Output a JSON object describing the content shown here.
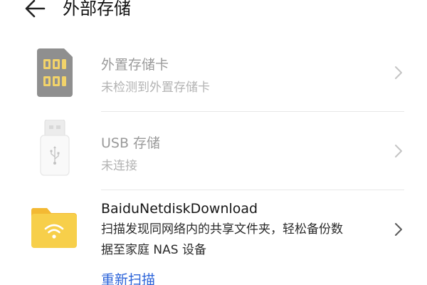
{
  "header": {
    "title": "外部存储",
    "back_icon": "arrow-left-icon"
  },
  "items": [
    {
      "title": "外置存储卡",
      "subtitle": "未检测到外置存储卡",
      "icon": "sim-card-icon",
      "state": "disabled"
    },
    {
      "title": "USB 存储",
      "subtitle": "未连接",
      "icon": "usb-drive-icon",
      "state": "disabled"
    },
    {
      "title": "BaiduNetdiskDownload",
      "subtitle_line1": "扫描发现同网络内的共享文件夹，轻松备份数",
      "subtitle_line2": "据至家庭 NAS 设备",
      "icon": "network-folder-icon",
      "state": "enabled"
    }
  ],
  "rescan_label": "重新扫描",
  "colors": {
    "link": "#2b63d9",
    "folder": "#f7cf4a",
    "sim_card": "#8f8f8f",
    "divider": "#e8e8e8"
  }
}
